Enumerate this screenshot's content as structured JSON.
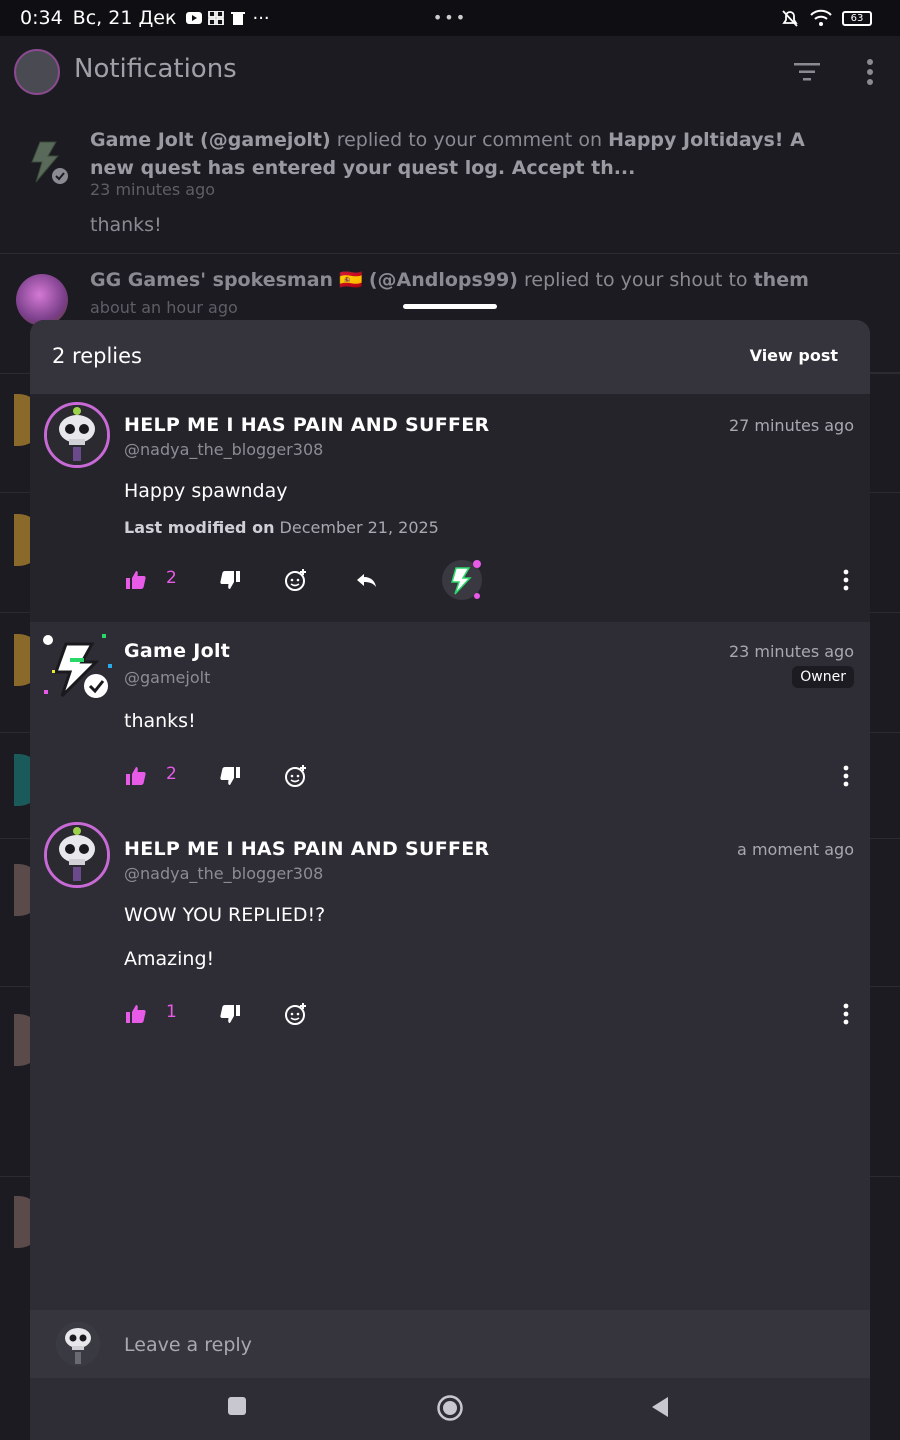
{
  "status_bar": {
    "time": "0:34",
    "date": "Вс, 21 Дек",
    "overflow": "···",
    "center_dots": "•••",
    "battery": "63"
  },
  "background_page": {
    "title": "Notifications",
    "notifications": [
      {
        "author": "Game Jolt (@gamejolt)",
        "action": " replied to your comment on ",
        "target": "Happy Joltidays! A new quest has entered your quest log.  Accept th...",
        "time": "23 minutes ago",
        "body": "thanks!"
      },
      {
        "author": "GG Games' spokesman",
        "flag": "🇪🇸",
        "handle": "(@Andlops99)",
        "action": " replied to your shout to ",
        "target": "them",
        "time": "about an hour ago"
      }
    ]
  },
  "sheet": {
    "title": "2 replies",
    "view_post": "View post",
    "comments": [
      {
        "name": "HELP ME I HAS PAIN AND SUFFER",
        "handle": "@nadya_the_blogger308",
        "time": "27 minutes ago",
        "lines": [
          "Happy spawnday"
        ],
        "modified_label": "Last modified on",
        "modified_date": "December 21, 2025",
        "likes": "2"
      },
      {
        "name": "Game Jolt",
        "handle": "@gamejolt",
        "time": "23 minutes ago",
        "badge": "Owner",
        "lines": [
          "thanks!"
        ],
        "likes": "2"
      },
      {
        "name": "HELP ME I HAS PAIN AND SUFFER",
        "handle": "@nadya_the_blogger308",
        "time": "a moment ago",
        "lines": [
          "WOW YOU REPLIED!?",
          "Amazing!"
        ],
        "likes": "1"
      }
    ]
  },
  "reply_bar": {
    "placeholder": "Leave a reply"
  },
  "colors": {
    "accent": "#e75be8",
    "sheet_bg": "#2e2c35",
    "page_bg": "#1c1b21"
  }
}
